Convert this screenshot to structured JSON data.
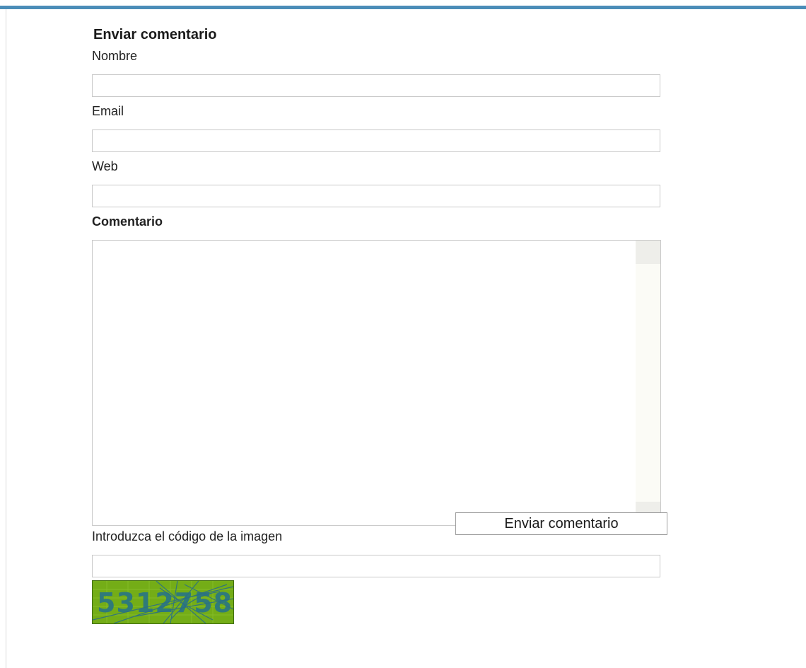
{
  "form": {
    "title": "Enviar comentario",
    "name_label": "Nombre",
    "name_value": "",
    "email_label": "Email",
    "email_value": "",
    "web_label": "Web",
    "web_value": "",
    "comment_label": "Comentario",
    "comment_value": "",
    "captcha_label": "Introduzca el código de la imagen",
    "captcha_value": "",
    "captcha_image_text": "5312758",
    "submit_label": "Enviar comentario"
  },
  "colors": {
    "top_bar": "#4b8db8",
    "captcha_bg": "#6da514",
    "captcha_text": "#2f7a7a"
  }
}
